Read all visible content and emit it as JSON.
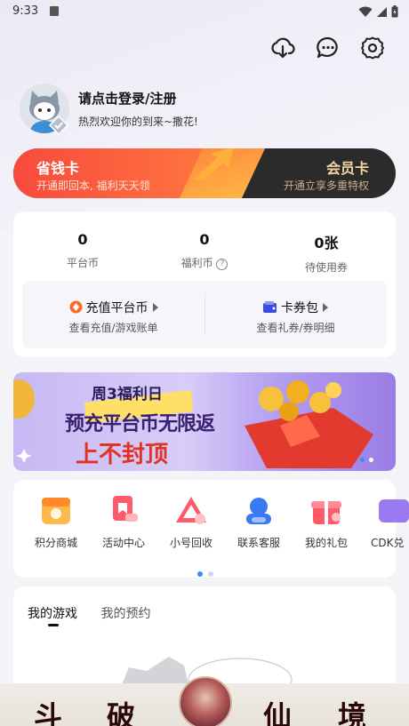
{
  "status_bar": {
    "time": "9:33"
  },
  "header": {
    "toolbar_icons": [
      "download-cloud-icon",
      "chat-bubble-icon",
      "settings-gear-icon"
    ]
  },
  "profile": {
    "login_label": "请点击登录/注册",
    "welcome_text": "热烈欢迎你的到来~撒花!"
  },
  "membership_banner": {
    "left_title": "省钱卡",
    "left_subtitle": "开通即回本, 福利天天领",
    "right_title": "会员卡",
    "right_subtitle": "开通立享多重特权"
  },
  "wallet": {
    "stats": [
      {
        "value": "0",
        "label": "平台币"
      },
      {
        "value": "0",
        "label": "福利币"
      },
      {
        "value": "0张",
        "label": "待使用券"
      }
    ],
    "help_glyph": "?",
    "actions": [
      {
        "title": "充值平台币",
        "subtitle": "查看充值/游戏账单"
      },
      {
        "title": "卡券包",
        "subtitle": "查看礼券/券明细"
      }
    ]
  },
  "promo_banner": {
    "line1": "周3福利日",
    "line2": "预充平台币无限返",
    "line3": "上不封顶"
  },
  "quick_menu": [
    {
      "label": "积分商城",
      "icon": "points-mall-icon"
    },
    {
      "label": "活动中心",
      "icon": "activity-flag-icon"
    },
    {
      "label": "小号回收",
      "icon": "recycle-triangle-icon"
    },
    {
      "label": "联系客服",
      "icon": "customer-service-icon"
    },
    {
      "label": "我的礼包",
      "icon": "gift-box-icon"
    },
    {
      "label": "CDK兑",
      "icon": "cdk-icon"
    }
  ],
  "games": {
    "tabs": [
      {
        "label": "我的游戏",
        "active": true
      },
      {
        "label": "我的预约",
        "active": false
      }
    ]
  },
  "bottom_ad": {
    "chars": [
      "斗",
      "破",
      "仙",
      "境"
    ]
  },
  "colors": {
    "accent": "#ff5a3c",
    "background": "#f4f4f8",
    "gold": "#f3d5a3"
  }
}
